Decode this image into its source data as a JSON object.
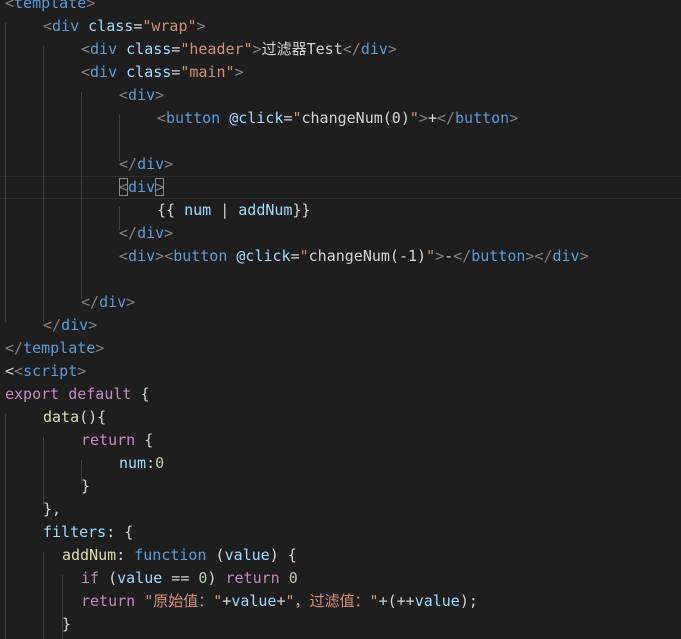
{
  "code": {
    "lines": [
      [
        {
          "t": "<",
          "c": "punc"
        },
        {
          "t": "template",
          "c": "tag"
        },
        {
          "t": ">",
          "c": "punc"
        }
      ],
      [
        {
          "t": "<",
          "c": "punc"
        },
        {
          "t": "div",
          "c": "tag"
        },
        {
          "t": " ",
          "c": "plain"
        },
        {
          "t": "class",
          "c": "attr"
        },
        {
          "t": "=",
          "c": "plain"
        },
        {
          "t": "\"wrap\"",
          "c": "str"
        },
        {
          "t": ">",
          "c": "punc"
        }
      ],
      [
        {
          "t": "<",
          "c": "punc"
        },
        {
          "t": "div",
          "c": "tag"
        },
        {
          "t": " ",
          "c": "plain"
        },
        {
          "t": "class",
          "c": "attr"
        },
        {
          "t": "=",
          "c": "plain"
        },
        {
          "t": "\"header\"",
          "c": "str"
        },
        {
          "t": ">",
          "c": "punc"
        },
        {
          "t": "过滤器Test",
          "c": "text"
        },
        {
          "t": "</",
          "c": "punc"
        },
        {
          "t": "div",
          "c": "tag"
        },
        {
          "t": ">",
          "c": "punc"
        }
      ],
      [
        {
          "t": "<",
          "c": "punc"
        },
        {
          "t": "div",
          "c": "tag"
        },
        {
          "t": " ",
          "c": "plain"
        },
        {
          "t": "class",
          "c": "attr"
        },
        {
          "t": "=",
          "c": "plain"
        },
        {
          "t": "\"main\"",
          "c": "str"
        },
        {
          "t": ">",
          "c": "punc"
        }
      ],
      [
        {
          "t": "<",
          "c": "punc"
        },
        {
          "t": "div",
          "c": "tag"
        },
        {
          "t": ">",
          "c": "punc"
        }
      ],
      [
        {
          "t": "<",
          "c": "punc"
        },
        {
          "t": "button",
          "c": "tag"
        },
        {
          "t": " ",
          "c": "plain"
        },
        {
          "t": "@click",
          "c": "attr"
        },
        {
          "t": "=",
          "c": "plain"
        },
        {
          "t": "\"",
          "c": "str"
        },
        {
          "t": "changeNum(0)",
          "c": "text"
        },
        {
          "t": "\"",
          "c": "str"
        },
        {
          "t": ">",
          "c": "punc"
        },
        {
          "t": "+",
          "c": "text"
        },
        {
          "t": "</",
          "c": "punc"
        },
        {
          "t": "button",
          "c": "tag"
        },
        {
          "t": ">",
          "c": "punc"
        }
      ],
      [],
      [
        {
          "t": "</",
          "c": "punc"
        },
        {
          "t": "div",
          "c": "tag"
        },
        {
          "t": ">",
          "c": "punc"
        }
      ],
      [
        {
          "t": "<",
          "c": "punc"
        },
        {
          "t": "div",
          "c": "tag"
        },
        {
          "t": ">",
          "c": "punc"
        }
      ],
      [
        {
          "t": "{{ ",
          "c": "text"
        },
        {
          "t": "num",
          "c": "var"
        },
        {
          "t": " | ",
          "c": "text"
        },
        {
          "t": "addNum",
          "c": "var"
        },
        {
          "t": "}}",
          "c": "text"
        }
      ],
      [
        {
          "t": "</",
          "c": "punc"
        },
        {
          "t": "div",
          "c": "tag"
        },
        {
          "t": ">",
          "c": "punc"
        }
      ],
      [
        {
          "t": "<",
          "c": "punc"
        },
        {
          "t": "div",
          "c": "tag"
        },
        {
          "t": ">",
          "c": "punc"
        },
        {
          "t": "<",
          "c": "punc"
        },
        {
          "t": "button",
          "c": "tag"
        },
        {
          "t": " ",
          "c": "plain"
        },
        {
          "t": "@click",
          "c": "attr"
        },
        {
          "t": "=",
          "c": "plain"
        },
        {
          "t": "\"",
          "c": "str"
        },
        {
          "t": "changeNum(-1)",
          "c": "text"
        },
        {
          "t": "\"",
          "c": "str"
        },
        {
          "t": ">",
          "c": "punc"
        },
        {
          "t": "-",
          "c": "text"
        },
        {
          "t": "</",
          "c": "punc"
        },
        {
          "t": "button",
          "c": "tag"
        },
        {
          "t": ">",
          "c": "punc"
        },
        {
          "t": "</",
          "c": "punc"
        },
        {
          "t": "div",
          "c": "tag"
        },
        {
          "t": ">",
          "c": "punc"
        }
      ],
      [],
      [
        {
          "t": "</",
          "c": "punc"
        },
        {
          "t": "div",
          "c": "tag"
        },
        {
          "t": ">",
          "c": "punc"
        }
      ],
      [
        {
          "t": "</",
          "c": "punc"
        },
        {
          "t": "div",
          "c": "tag"
        },
        {
          "t": ">",
          "c": "punc"
        }
      ],
      [
        {
          "t": "</",
          "c": "punc"
        },
        {
          "t": "template",
          "c": "tag"
        },
        {
          "t": ">",
          "c": "punc"
        }
      ],
      [
        {
          "t": "<",
          "c": "text"
        },
        {
          "t": "<",
          "c": "punc"
        },
        {
          "t": "script",
          "c": "tag"
        },
        {
          "t": ">",
          "c": "punc"
        }
      ],
      [
        {
          "t": "export",
          "c": "kw"
        },
        {
          "t": " ",
          "c": "plain"
        },
        {
          "t": "default",
          "c": "kw"
        },
        {
          "t": " {",
          "c": "plain"
        }
      ],
      [
        {
          "t": "data",
          "c": "fn"
        },
        {
          "t": "(){",
          "c": "plain"
        }
      ],
      [
        {
          "t": "return",
          "c": "kw"
        },
        {
          "t": " {",
          "c": "plain"
        }
      ],
      [
        {
          "t": "num",
          "c": "var"
        },
        {
          "t": ":",
          "c": "plain"
        },
        {
          "t": "0",
          "c": "num"
        }
      ],
      [
        {
          "t": "}",
          "c": "plain"
        }
      ],
      [
        {
          "t": "},",
          "c": "plain"
        }
      ],
      [
        {
          "t": "filters",
          "c": "var"
        },
        {
          "t": ": {",
          "c": "plain"
        }
      ],
      [
        {
          "t": "addNum",
          "c": "fn"
        },
        {
          "t": ": ",
          "c": "plain"
        },
        {
          "t": "function",
          "c": "storage"
        },
        {
          "t": " (",
          "c": "plain"
        },
        {
          "t": "value",
          "c": "var"
        },
        {
          "t": ") {",
          "c": "plain"
        }
      ],
      [
        {
          "t": "if",
          "c": "kw"
        },
        {
          "t": " (",
          "c": "plain"
        },
        {
          "t": "value",
          "c": "var"
        },
        {
          "t": " == ",
          "c": "plain"
        },
        {
          "t": "0",
          "c": "num"
        },
        {
          "t": ") ",
          "c": "plain"
        },
        {
          "t": "return",
          "c": "kw"
        },
        {
          "t": " ",
          "c": "plain"
        },
        {
          "t": "0",
          "c": "num"
        }
      ],
      [
        {
          "t": "return",
          "c": "kw"
        },
        {
          "t": " ",
          "c": "plain"
        },
        {
          "t": "\"原始值：\"",
          "c": "str"
        },
        {
          "t": "+",
          "c": "plain"
        },
        {
          "t": "value",
          "c": "var"
        },
        {
          "t": "+",
          "c": "plain"
        },
        {
          "t": "\"，过滤值：\"",
          "c": "str"
        },
        {
          "t": "+(++",
          "c": "plain"
        },
        {
          "t": "value",
          "c": "var"
        },
        {
          "t": ");",
          "c": "plain"
        }
      ],
      [
        {
          "t": "}",
          "c": "plain"
        }
      ]
    ]
  }
}
